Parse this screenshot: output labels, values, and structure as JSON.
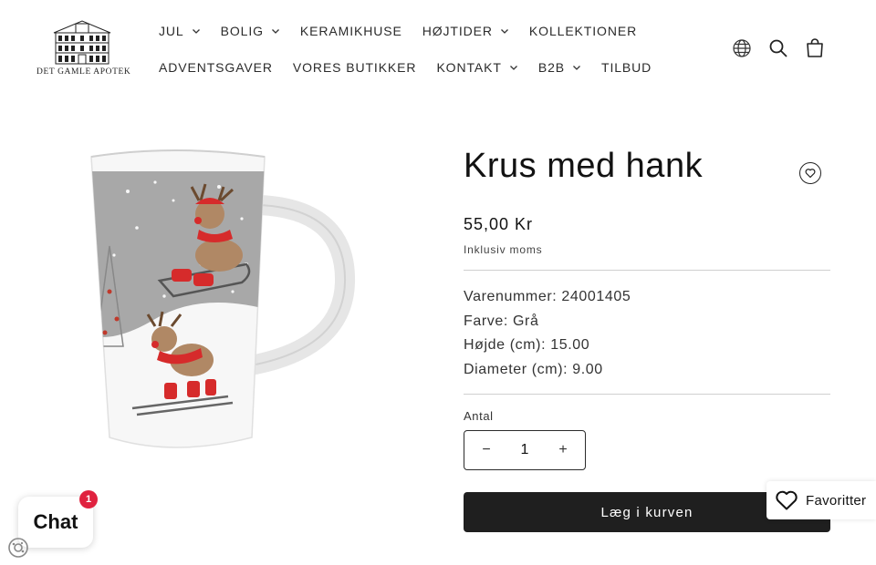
{
  "brand": {
    "name": "DET GAMLE APOTEK"
  },
  "nav": {
    "row1": [
      {
        "label": "JUL",
        "dropdown": true
      },
      {
        "label": "BOLIG",
        "dropdown": true
      },
      {
        "label": "KERAMIKHUSE",
        "dropdown": false
      },
      {
        "label": "HØJTIDER",
        "dropdown": true
      },
      {
        "label": "KOLLEKTIONER",
        "dropdown": false
      }
    ],
    "row2": [
      {
        "label": "ADVENTSGAVER",
        "dropdown": false
      },
      {
        "label": "VORES BUTIKKER",
        "dropdown": false
      },
      {
        "label": "KONTAKT",
        "dropdown": true
      },
      {
        "label": "B2B",
        "dropdown": true
      },
      {
        "label": "TILBUD",
        "dropdown": false
      }
    ]
  },
  "header_icons": [
    "globe-icon",
    "search-icon",
    "cart-icon"
  ],
  "product": {
    "title": "Krus med hank",
    "price": "55,00 Kr",
    "tax_note": "Inklusiv moms",
    "specs": [
      "Varenummer: 24001405",
      "Farve: Grå",
      "Højde (cm): 15.00",
      "Diameter (cm): 9.00"
    ],
    "quantity_label": "Antal",
    "quantity_value": "1",
    "qty_minus": "−",
    "qty_plus": "+",
    "add_to_cart": "Læg i kurven",
    "image_icon": "reindeer-mug-image"
  },
  "favorites": {
    "label": "Favoritter",
    "icon": "heart-icon"
  },
  "chat": {
    "label": "Chat",
    "badge": "1"
  },
  "colors": {
    "button_bg": "#1f1f1f",
    "badge": "#e0223f",
    "text": "#121212"
  }
}
